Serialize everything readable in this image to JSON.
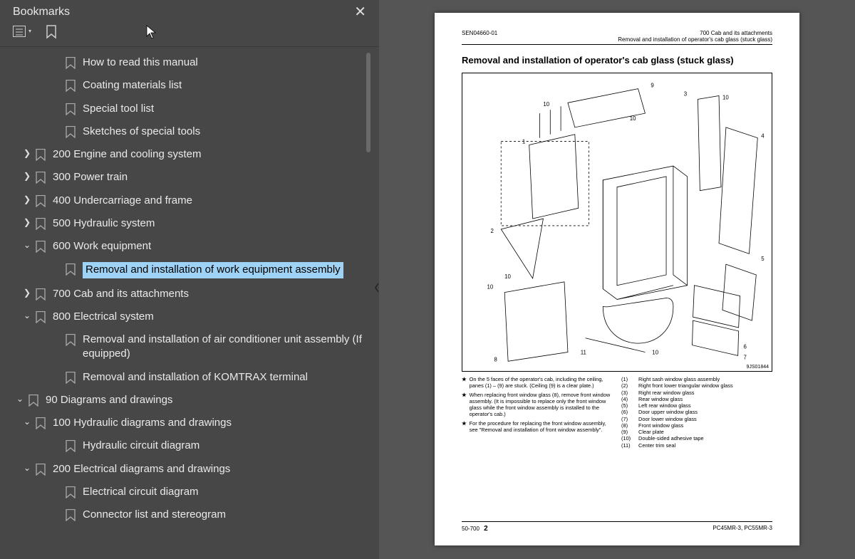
{
  "sidebar": {
    "title": "Bookmarks",
    "items": [
      {
        "level": 3,
        "arrow": "",
        "label": "How to read this manual"
      },
      {
        "level": 3,
        "arrow": "",
        "label": "Coating materials list"
      },
      {
        "level": 3,
        "arrow": "",
        "label": "Special tool list"
      },
      {
        "level": 3,
        "arrow": "",
        "label": "Sketches of special tools"
      },
      {
        "level": 1,
        "arrow": ">",
        "label": "200 Engine and cooling system"
      },
      {
        "level": 1,
        "arrow": ">",
        "label": "300 Power train"
      },
      {
        "level": 1,
        "arrow": ">",
        "label": "400 Undercarriage and frame"
      },
      {
        "level": 1,
        "arrow": ">",
        "label": "500 Hydraulic system"
      },
      {
        "level": 1,
        "arrow": "v",
        "label": "600 Work equipment"
      },
      {
        "level": 3,
        "arrow": "",
        "label": "Removal and installation of work equipment assembly",
        "selected": true
      },
      {
        "level": 1,
        "arrow": ">",
        "label": "700 Cab and its attachments"
      },
      {
        "level": 1,
        "arrow": "v",
        "label": "800 Electrical system"
      },
      {
        "level": 3,
        "arrow": "",
        "label": "Removal and installation of air conditioner unit assembly (If equipped)"
      },
      {
        "level": 3,
        "arrow": "",
        "label": "Removal and installation of KOMTRAX terminal"
      },
      {
        "level": 0,
        "arrow": "v",
        "label": "90 Diagrams and drawings"
      },
      {
        "level": 1,
        "arrow": "v",
        "label": "100 Hydraulic diagrams and drawings"
      },
      {
        "level": 3,
        "arrow": "",
        "label": "Hydraulic circuit diagram"
      },
      {
        "level": 1,
        "arrow": "v",
        "label": "200 Electrical diagrams and drawings"
      },
      {
        "level": 3,
        "arrow": "",
        "label": "Electrical circuit diagram"
      },
      {
        "level": 3,
        "arrow": "",
        "label": "Connector list and stereogram"
      }
    ]
  },
  "doc": {
    "header_left": "SEN04660-01",
    "header_right_1": "700 Cab and its attachments",
    "header_right_2": "Removal and installation of operator's cab glass (stuck glass)",
    "title": "Removal and installation of operator's cab glass (stuck glass)",
    "figure_code": "9JS01844",
    "bullets": [
      "On the 5 faces of the operator's cab, including the ceiling, panes (1) – (9) are stuck. (Ceiling (9) is a clear plate.)",
      "When replacing front window glass (8), remove front window assembly. (It is impossible to replace only the front window glass while the front window assembly is installed to the operator's cab.)",
      "For the procedure for replacing the front window assembly, see \"Removal and installation of front window assembly\"."
    ],
    "parts": [
      {
        "n": "(1)",
        "t": "Right sash window glass assembly"
      },
      {
        "n": "(2)",
        "t": "Right front lower triangular window glass"
      },
      {
        "n": "(3)",
        "t": "Right rear window glass"
      },
      {
        "n": "(4)",
        "t": "Rear window glass"
      },
      {
        "n": "(5)",
        "t": "Left rear window glass"
      },
      {
        "n": "(6)",
        "t": "Door upper window glass"
      },
      {
        "n": "(7)",
        "t": "Door lower window glass"
      },
      {
        "n": "(8)",
        "t": "Front window glass"
      },
      {
        "n": "(9)",
        "t": "Clear plate"
      },
      {
        "n": "(10)",
        "t": "Double-sided adhesive tape"
      },
      {
        "n": "(11)",
        "t": "Center trim seal"
      }
    ],
    "footer_left": "50-700",
    "footer_pagenum": "2",
    "footer_right": "PC45MR-3, PC55MR-3"
  }
}
